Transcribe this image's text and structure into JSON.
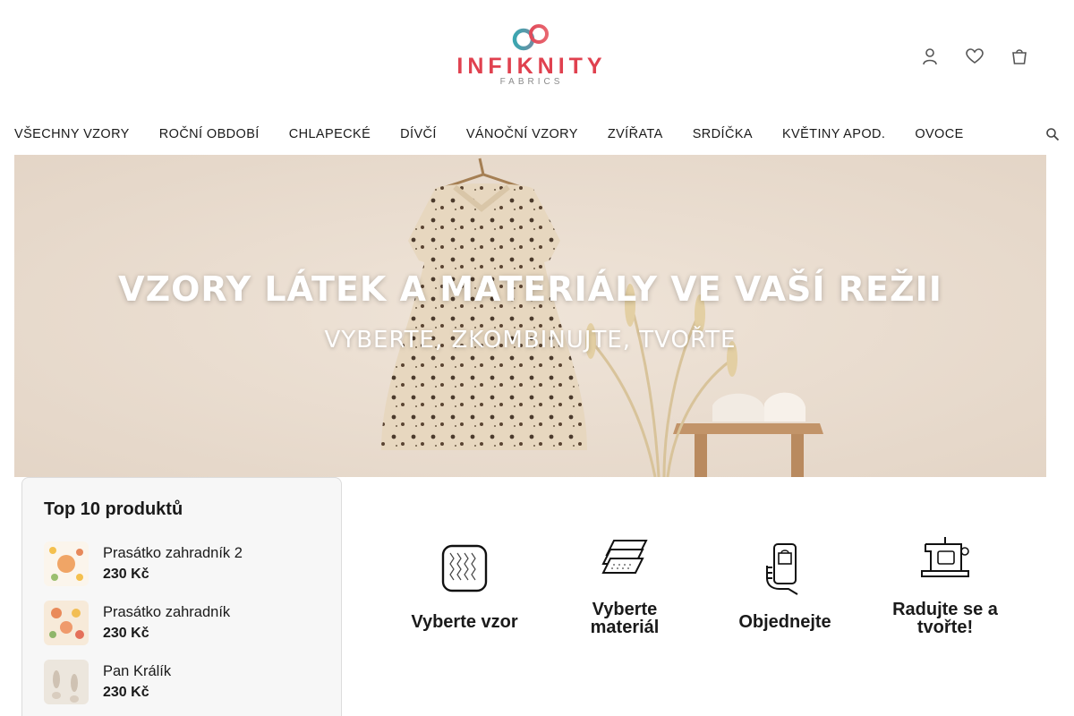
{
  "brand": {
    "name": "INFIKNITY",
    "sub": "FABRICS",
    "accent": "#e0414f"
  },
  "header": {
    "icons": [
      {
        "name": "user-icon"
      },
      {
        "name": "heart-icon"
      },
      {
        "name": "cart-icon"
      }
    ]
  },
  "nav": {
    "items": [
      "VŠECHNY VZORY",
      "ROČNÍ OBDOBÍ",
      "CHLAPECKÉ",
      "DÍVČÍ",
      "VÁNOČNÍ VZORY",
      "ZVÍŘATA",
      "SRDÍČKA",
      "KVĚTINY APOD.",
      "OVOCE"
    ]
  },
  "hero": {
    "title": "VZORY LÁTEK A MATERIÁLY VE VAŠÍ REŽII",
    "subtitle": "VYBERTE, ZKOMBINUJTE, TVOŘTE"
  },
  "top10": {
    "title": "Top 10 produktů",
    "products": [
      {
        "name": "Prasátko zahradník 2",
        "price": "230 Kč"
      },
      {
        "name": "Prasátko zahradník",
        "price": "230 Kč"
      },
      {
        "name": "Pan Králík",
        "price": "230 Kč"
      }
    ]
  },
  "steps": [
    {
      "label": "Vyberte vzor",
      "icon": "fabric-swatch-icon"
    },
    {
      "label": "Vyberte materiál",
      "icon": "fabric-layers-icon"
    },
    {
      "label": "Objednejte",
      "icon": "phone-order-icon"
    },
    {
      "label": "Radujte se a tvořte!",
      "icon": "sewing-machine-icon"
    }
  ]
}
